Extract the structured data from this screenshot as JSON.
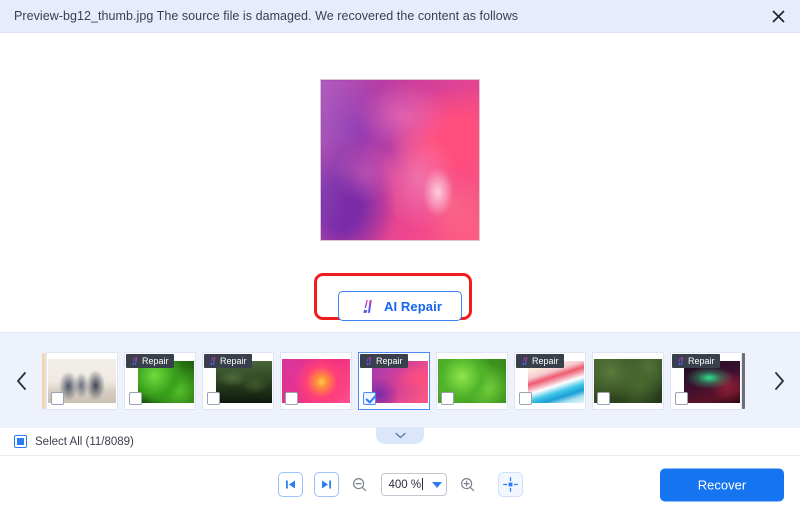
{
  "header": {
    "title": "Preview-bg12_thumb.jpg The source file is damaged. We recovered the content as follows",
    "close_icon": "close-icon"
  },
  "preview": {
    "image_alt": "pink-purple-flower-petal-closeup",
    "zoom_applied": "400 %"
  },
  "repair": {
    "label": "AI Repair",
    "icon": "ai-gradient-icon",
    "highlight_color": "#ef1d1d",
    "border_color": "#3b82f6",
    "text_color": "#1666ef"
  },
  "thumbstrip": {
    "prev_icon": "chevron-left-icon",
    "next_icon": "chevron-right-icon",
    "expand_icon": "chevron-down-icon",
    "badge_label": "Repair",
    "badge_icon": "ai-gradient-icon",
    "items": [
      {
        "art": "art-meeting",
        "badge": false,
        "checked": false,
        "selected": false,
        "name": "thumb-meeting"
      },
      {
        "art": "art-leaf-dark",
        "badge": true,
        "checked": false,
        "selected": false,
        "name": "thumb-leaf"
      },
      {
        "art": "art-forest",
        "badge": true,
        "checked": false,
        "selected": false,
        "name": "thumb-forest"
      },
      {
        "art": "art-dahlia",
        "badge": false,
        "checked": false,
        "selected": false,
        "name": "thumb-dahlia"
      },
      {
        "art": "art-petal",
        "badge": true,
        "checked": true,
        "selected": true,
        "name": "thumb-petal"
      },
      {
        "art": "art-clover",
        "badge": false,
        "checked": false,
        "selected": false,
        "name": "thumb-clover"
      },
      {
        "art": "art-abstract",
        "badge": true,
        "checked": false,
        "selected": false,
        "name": "thumb-abstract"
      },
      {
        "art": "art-aerial",
        "badge": false,
        "checked": false,
        "selected": false,
        "name": "thumb-aerial"
      },
      {
        "art": "art-aurora",
        "badge": true,
        "checked": false,
        "selected": false,
        "name": "thumb-aurora"
      }
    ]
  },
  "selection": {
    "select_all_label": "Select All (11/8089)",
    "selected_count": 11,
    "total_count": 8089,
    "state": "indeterminate"
  },
  "footer": {
    "first_page_icon": "skip-to-start-icon",
    "last_page_icon": "skip-to-end-icon",
    "zoom_out_icon": "zoom-out-icon",
    "zoom_in_icon": "zoom-in-icon",
    "fit_screen_icon": "fit-to-screen-icon",
    "zoom_value": "400 %",
    "zoom_dropdown_icon": "chevron-down-icon",
    "recover_label": "Recover",
    "recover_color": "#1575f0"
  }
}
